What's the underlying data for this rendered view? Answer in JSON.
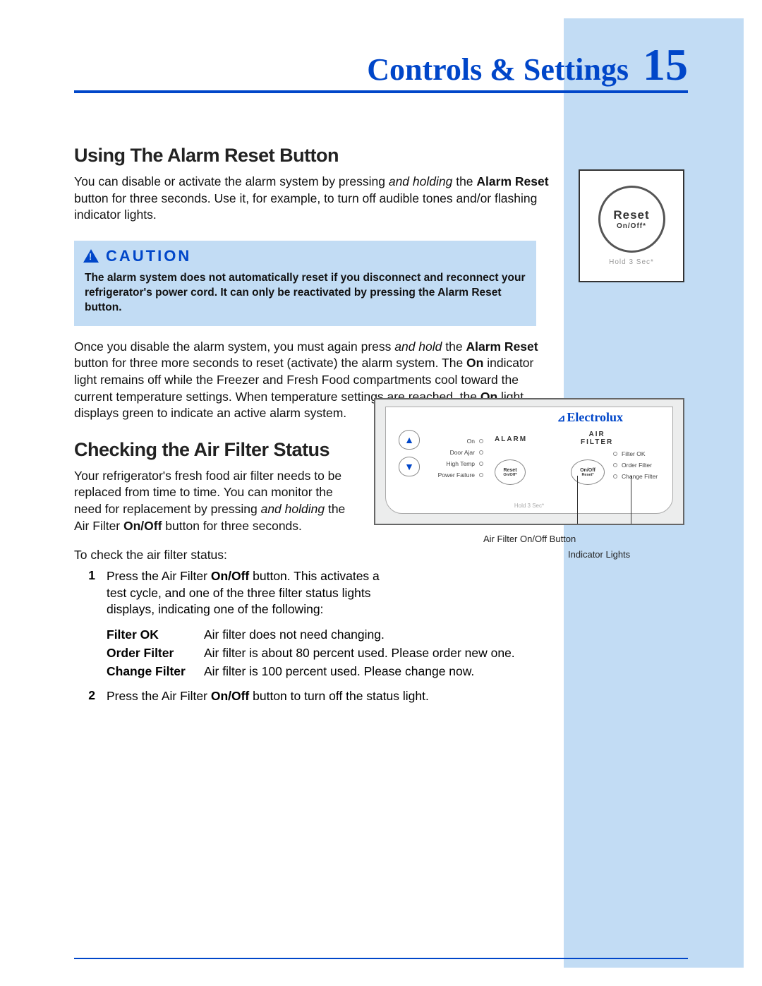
{
  "header": {
    "title": "Controls & Settings",
    "page_number": "15"
  },
  "reset_callout": {
    "line1": "Reset",
    "line2": "On/Off*",
    "sub": "Hold 3 Sec*"
  },
  "section1": {
    "heading": "Using The Alarm Reset Button",
    "p1_a": "You can disable or activate the alarm system by pressing ",
    "p1_b": "and holding",
    "p1_c": " the ",
    "p1_d": "Alarm Reset",
    "p1_e": " button for three seconds. Use it, for example, to turn off audible tones and/or flashing indicator lights.",
    "caution_head": "CAUTION",
    "caution_body": "The alarm system does not automatically reset if you disconnect and reconnect your refrigerator's power cord. It can only be reactivated by pressing the Alarm Reset button.",
    "p2_a": "Once you disable the alarm system, you must again press ",
    "p2_b": "and hold",
    "p2_c": " the ",
    "p2_d": "Alarm Reset",
    "p2_e": " button for three more seconds to reset (activate) the alarm system. The ",
    "p2_f": "On",
    "p2_g": " indicator light remains off while the Freezer and Fresh Food compartments cool toward the current temperature settings. When temperature settings are reached, the ",
    "p2_h": "On",
    "p2_i": " light displays green to indicate an active alarm system."
  },
  "section2": {
    "heading": "Checking the Air Filter Status",
    "p1_a": "Your refrigerator's fresh food air filter needs to be replaced from time to time. You can monitor the need for replacement by pressing ",
    "p1_b": "and holding",
    "p1_c": " the Air Filter ",
    "p1_d": "On/Off",
    "p1_e": " button for three seconds.",
    "p2": "To check the air filter status:",
    "step1_a": "Press the Air Filter ",
    "step1_b": "On/Off",
    "step1_c": " button. This activates a test cycle, and one of the three filter status lights displays, indicating one of the following:",
    "status": [
      {
        "label": "Filter OK",
        "desc": "Air filter does not need changing."
      },
      {
        "label": "Order Filter",
        "desc": "Air filter is about 80 percent used. Please order new one."
      },
      {
        "label": "Change Filter",
        "desc": "Air filter is 100 percent used. Please change now."
      }
    ],
    "step2_a": "Press the Air Filter ",
    "step2_b": "On/Off",
    "step2_c": " button to turn off the status light.",
    "num1": "1",
    "num2": "2"
  },
  "panel": {
    "brand": "Electrolux",
    "alarm_head": "ALARM",
    "airfilter_head1": "AIR",
    "airfilter_head2": "FILTER",
    "alarm_rows": [
      "On",
      "Door Ajar",
      "High Temp",
      "Power Failure"
    ],
    "filter_rows": [
      "Filter OK",
      "Order Filter",
      "Change Filter"
    ],
    "reset_btn1": "Reset",
    "reset_btn2": "On/Off*",
    "onoff_btn1": "On/Off",
    "onoff_btn2": "Reset*",
    "hold": "Hold 3 Sec*",
    "callout1": "Air Filter On/Off Button",
    "callout2": "Indicator Lights"
  }
}
